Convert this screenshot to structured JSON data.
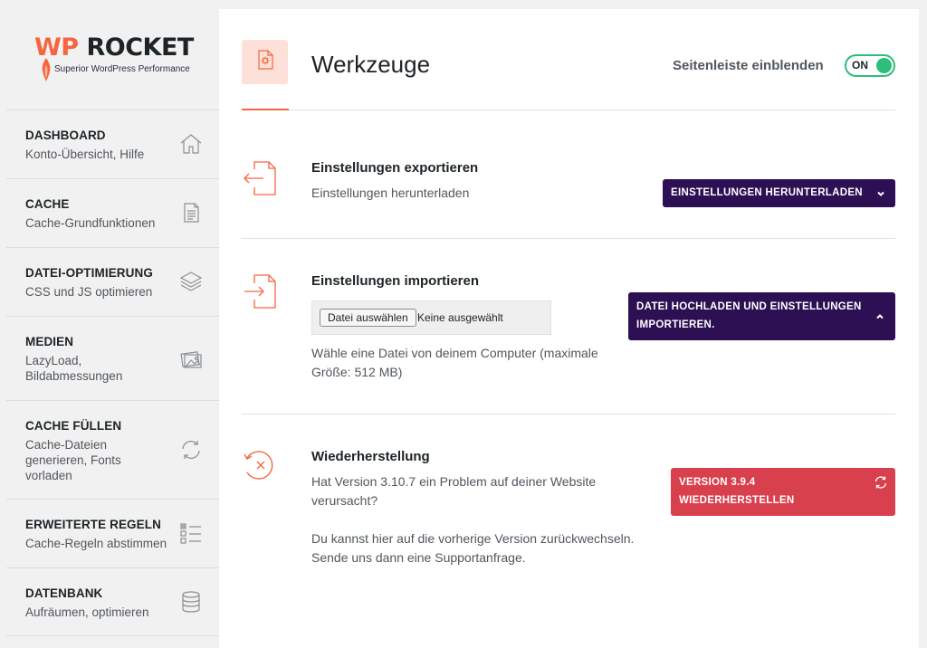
{
  "logo": {
    "wp": "WP",
    "rocket": "ROCKET",
    "tagline": "Superior WordPress Performance"
  },
  "sidebar": {
    "items": [
      {
        "title": "DASHBOARD",
        "subtitle": "Konto-Übersicht, Hilfe",
        "icon": "home-icon"
      },
      {
        "title": "CACHE",
        "subtitle": "Cache-Grundfunktionen",
        "icon": "document-icon"
      },
      {
        "title": "DATEI-OPTIMIERUNG",
        "subtitle": "CSS und JS optimieren",
        "icon": "layers-icon"
      },
      {
        "title": "MEDIEN",
        "subtitle": "LazyLoad, Bildabmessungen",
        "icon": "images-icon"
      },
      {
        "title": "CACHE FÜLLEN",
        "subtitle": "Cache-Dateien generieren, Fonts vorladen",
        "icon": "refresh-icon"
      },
      {
        "title": "ERWEITERTE REGELN",
        "subtitle": "Cache-Regeln abstimmen",
        "icon": "checklist-icon"
      },
      {
        "title": "DATENBANK",
        "subtitle": "Aufräumen, optimieren",
        "icon": "database-icon"
      }
    ]
  },
  "header": {
    "title": "Werkzeuge",
    "toggle_label": "Seitenleiste einblenden",
    "toggle_state": "ON",
    "icon": "settings-file-icon"
  },
  "export": {
    "title": "Einstellungen exportieren",
    "description": "Einstellungen herunterladen",
    "button": "EINSTELLUNGEN HERUNTERLADEN",
    "icon": "export-icon"
  },
  "import": {
    "title": "Einstellungen importieren",
    "file_button": "Datei auswählen",
    "file_status": "Keine ausgewählt",
    "help": "Wähle eine Datei von deinem Computer (maximale Größe: 512 MB)",
    "button_line1": "DATEI HOCHLADEN UND EINSTELLUNGEN",
    "button_line2": "IMPORTIEREN.",
    "icon": "import-icon"
  },
  "rollback": {
    "title": "Wiederherstellung",
    "text1": "Hat Version 3.10.7 ein Problem auf deiner Website verursacht?",
    "text2": "Du kannst hier auf die vorherige Version zurückwechseln. Sende uns dann eine Supportanfrage.",
    "button_line1": "VERSION 3.9.4",
    "button_line2": "WIEDERHERSTELLEN",
    "icon": "rollback-icon"
  },
  "colors": {
    "accent": "#f56640",
    "purple": "#2d0f54",
    "red": "#d9404d",
    "green": "#2ebd7b"
  }
}
